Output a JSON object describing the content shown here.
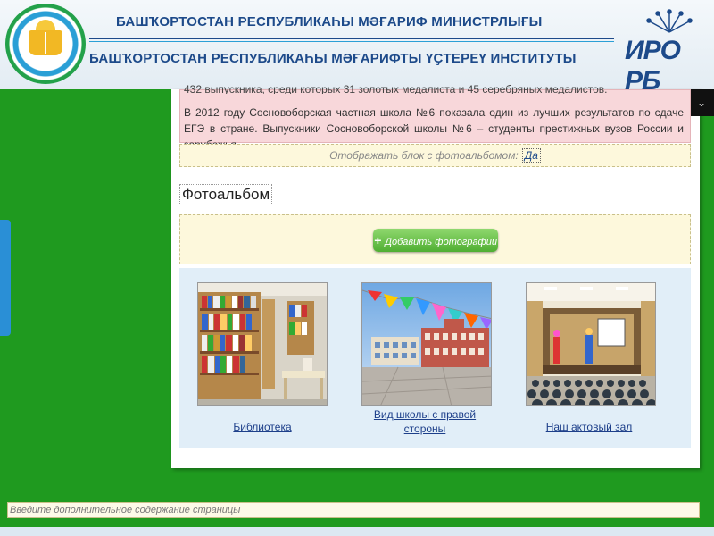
{
  "header": {
    "line1": "БАШҠОРТОСТАН РЕСПУБЛИКАҺЫ МӘҒАРИФ МИНИСТРЛЫҒЫ",
    "line2": "БАШҠОРТОСТАН РЕСПУБЛИКАҺЫ МӘҒАРИФТЫ ҮҪТЕРЕҮ ИНСТИТУТЫ",
    "brand": "ИРО РБ"
  },
  "content": {
    "partial_line": "432 выпускника, среди которых 31 золотых медалиста и 45 серебряных медалистов.",
    "paragraph": "В 2012 году Сосновоборская частная школа №6 показала один из лучших результатов по сдаче ЕГЭ в стране. Выпускники Сосновоборской  школы №6 – студенты престижных вузов России и зарубежья.",
    "toggle_label": "Отображать блок с фотоальбомом:",
    "toggle_value": "Да",
    "album_title": "Фотоальбом",
    "add_photos": "Добавить фотографии",
    "photos": [
      {
        "caption": "Библиотека"
      },
      {
        "caption": "Вид школы с правой стороны"
      },
      {
        "caption": "Наш актовый зал"
      }
    ]
  },
  "bottom": {
    "placeholder": "Введите дополнительное содержание страницы"
  },
  "colors": {
    "background": "#1f9a1f",
    "header_text": "#1d4a8a",
    "pink_box": "#f8d7da",
    "gallery_bg": "#e1eef8",
    "add_button": "#4fae32"
  }
}
